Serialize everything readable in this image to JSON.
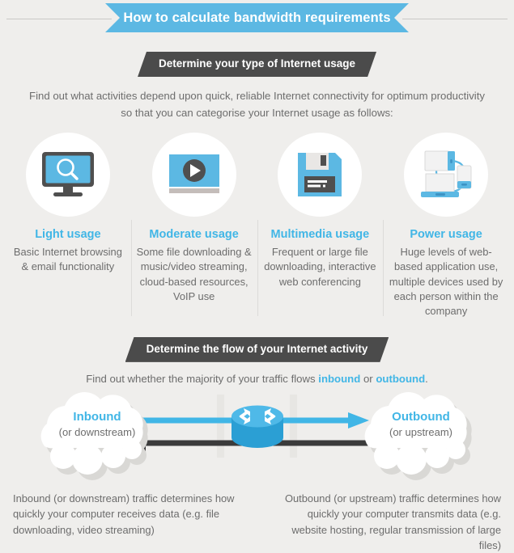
{
  "header": {
    "title": "How to calculate bandwidth requirements"
  },
  "section1": {
    "heading": "Determine your type of Internet usage",
    "intro_line1": "Find out what activities depend upon quick, reliable Internet connectivity for optimum productivity",
    "intro_line2": "so that you can categorise your Internet usage as follows:",
    "columns": [
      {
        "icon": "monitor-search-icon",
        "title": "Light usage",
        "description": "Basic Internet browsing & email functionality"
      },
      {
        "icon": "video-play-icon",
        "title": "Moderate usage",
        "description": "Some file downloading & music/video streaming, cloud-based resources, VoIP use"
      },
      {
        "icon": "floppy-disk-icon",
        "title": "Multimedia usage",
        "description": "Frequent or large file downloading, interactive web conferencing"
      },
      {
        "icon": "multiple-devices-icon",
        "title": "Power usage",
        "description": "Huge levels of web-based application use, multiple devices used by each person within the company"
      }
    ]
  },
  "section2": {
    "heading": "Determine the flow of your Internet activity",
    "flow_text_before": "Find out whether the majority of your traffic flows ",
    "flow_highlight_1": "inbound",
    "flow_text_middle": " or ",
    "flow_highlight_2": "outbound",
    "flow_text_after": ".",
    "diagram": {
      "left_cloud_title": "Inbound",
      "left_cloud_subtitle": "(or downstream)",
      "right_cloud_title": "Outbound",
      "right_cloud_subtitle": "(or upstream)",
      "router_label": "router-icon"
    },
    "caption_left": "Inbound (or downstream) traffic determines how quickly your computer receives data (e.g. file downloading, video streaming)",
    "caption_right": "Outbound (or upstream) traffic determines how quickly your computer transmits data (e.g. website hosting, regular transmission of large files)"
  },
  "colors": {
    "accent_blue": "#41b6e6",
    "banner_blue": "#5cb8e3",
    "dark_tag": "#4b4b4b",
    "background": "#efeeec",
    "arrow_dark": "#3b3b3b"
  }
}
